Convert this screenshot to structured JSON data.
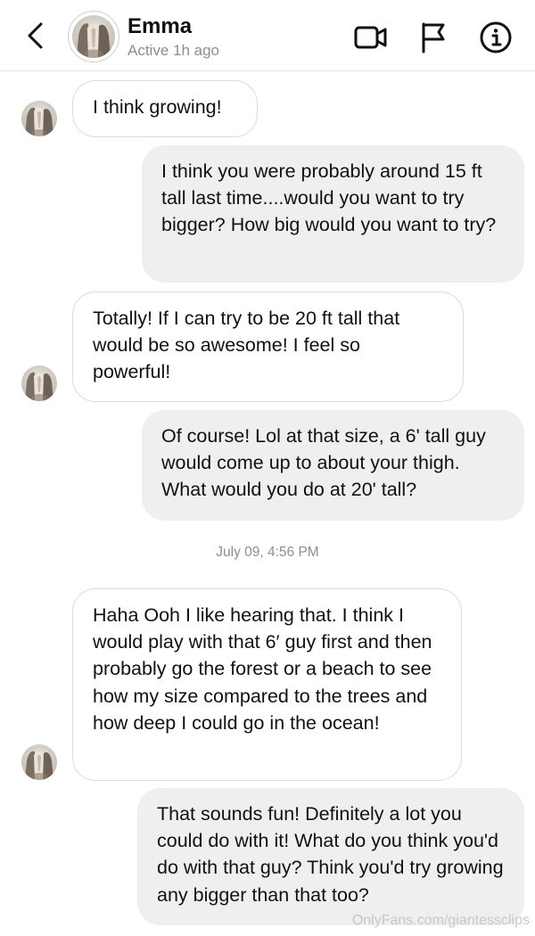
{
  "header": {
    "contact_name": "Emma",
    "status": "Active 1h ago",
    "icons": [
      "back-chevron-icon",
      "video-call-icon",
      "flag-icon",
      "info-icon"
    ]
  },
  "messages": [
    {
      "from": "them",
      "text": "I think growing!"
    },
    {
      "from": "me",
      "text": "I think you were probably around 15 ft tall last time....would you want to try bigger? How big would you want to try?"
    },
    {
      "from": "them",
      "text": "Totally! If I can try to be 20 ft tall that would be so awesome! I feel so powerful!"
    },
    {
      "from": "me",
      "text": "Of course! Lol at that size, a 6' tall guy would come up to about your thigh. What would you do at 20' tall?"
    },
    {
      "from": "them",
      "text": "Haha Ooh I like hearing that. I think I would play with that 6′ guy first and then probably go the forest or a beach to see how my size compared to the trees and how deep I could go in the ocean!"
    },
    {
      "from": "me",
      "text": "That sounds fun! Definitely a lot you could do with it! What do you think you'd do with that guy? Think you'd try growing any bigger than that too?"
    }
  ],
  "timestamp": "July 09, 4:56 PM",
  "watermark": "OnlyFans.com/giantessclips"
}
